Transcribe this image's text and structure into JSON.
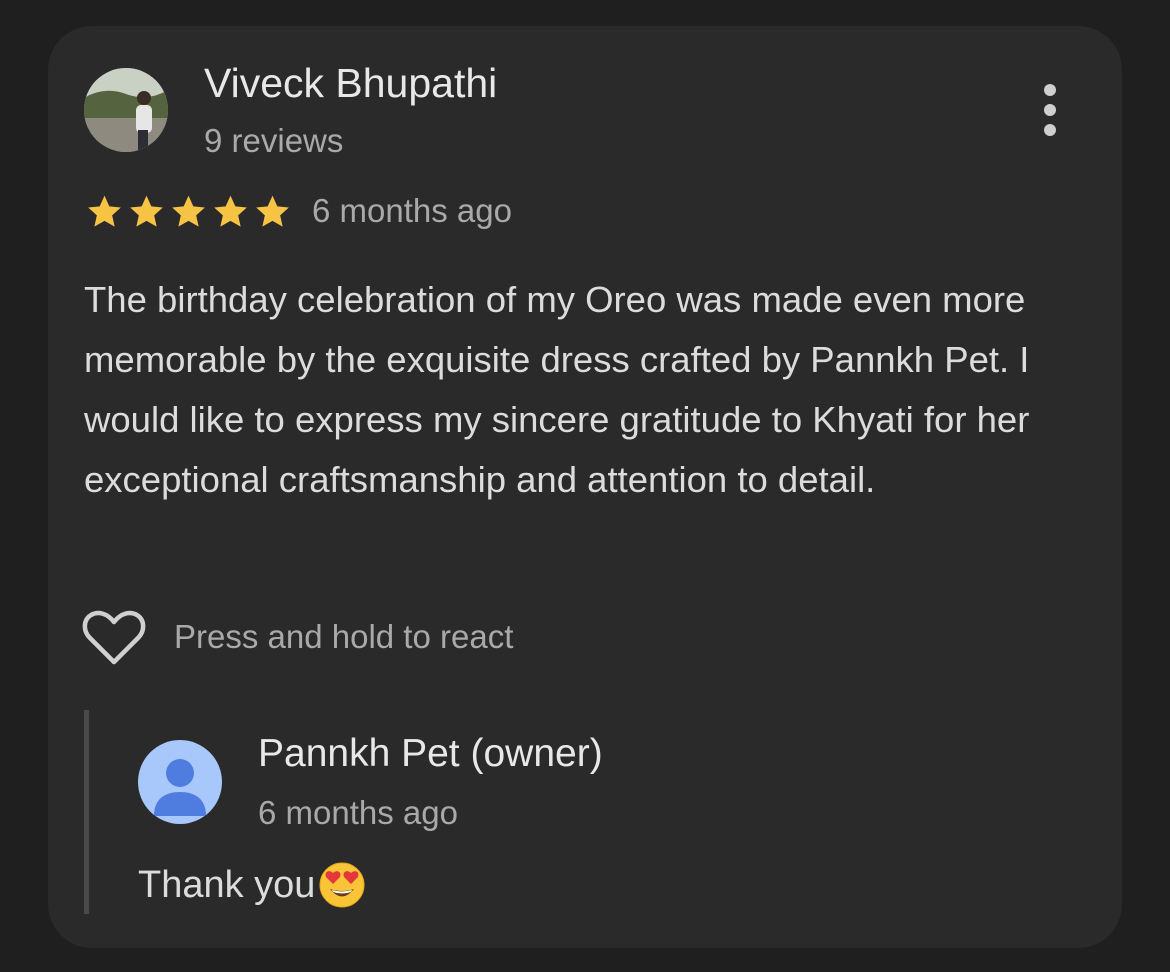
{
  "review": {
    "reviewer_name": "Viveck Bhupathi",
    "review_count": "9 reviews",
    "rating": 5,
    "rating_max": 5,
    "time_ago": "6 months ago",
    "text": "The birthday celebration of my Oreo was made even more memorable by the exquisite dress crafted by Pannkh Pet. I would like to express my sincere gratitude to Khyati for her exceptional craftsmanship and attention to detail.",
    "react_hint": "Press and hold to react"
  },
  "owner_reply": {
    "name": "Pannkh Pet (owner)",
    "time_ago": "6 months ago",
    "text": "Thank you"
  },
  "icons": {
    "more": "more-vert-icon",
    "star": "star-icon",
    "heart": "heart-outline-icon",
    "owner_avatar": "person-icon",
    "emoji": "heart-eyes-emoji-icon"
  },
  "colors": {
    "background": "#1f1f1f",
    "card": "#2a2a2b",
    "star": "#f6c344",
    "primary_text": "#e8e8e8",
    "secondary_text": "#a9a9a9",
    "owner_avatar_bg": "#a8c7fa",
    "owner_avatar_fg": "#4f7ddf"
  }
}
